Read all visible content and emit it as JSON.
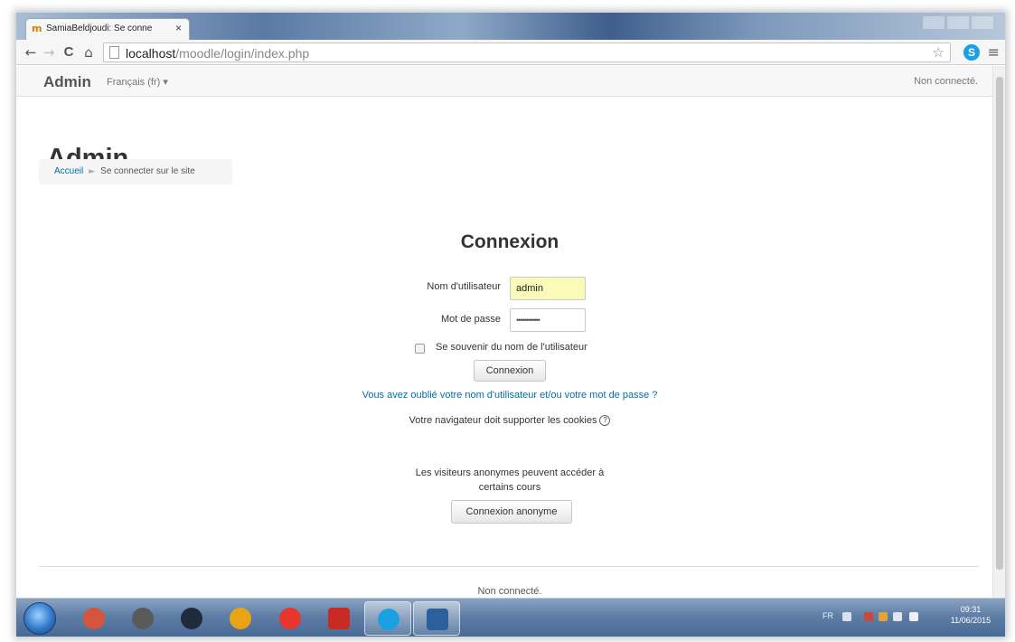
{
  "browser": {
    "tab_title": "SamiaBeldjoudi: Se conne",
    "tab_close": "×",
    "url_host": "localhost",
    "url_path": "/moodle/login/index.php",
    "back": "←",
    "forward": "→",
    "reload": "C",
    "home": "⌂",
    "star": "☆",
    "skype_ext": "S",
    "menu": "≡"
  },
  "navbar": {
    "brand": "Admin",
    "language": "Français (fr) ▾",
    "status": "Non connecté."
  },
  "page": {
    "heading": "Admin",
    "breadcrumb": {
      "home": "Accueil",
      "separator": "►",
      "current": "Se connecter sur le site"
    }
  },
  "login": {
    "title": "Connexion",
    "username_label": "Nom d'utilisateur",
    "username_value": "admin",
    "password_label": "Mot de passe",
    "password_value": "••••••••••••",
    "remember_label": "Se souvenir du nom de l'utilisateur",
    "remember_checked": false,
    "submit": "Connexion",
    "forgot_link": "Vous avez oublié votre nom d'utilisateur et/ou votre mot de passe ?",
    "cookies_notice": "Votre navigateur doit supporter les cookies",
    "help_icon": "?"
  },
  "guest": {
    "line1": "Les visiteurs anonymes peuvent accéder à",
    "line2": "certains cours",
    "button": "Connexion anonyme"
  },
  "footer": {
    "status": "Non connecté."
  },
  "taskbar": {
    "apps": [
      {
        "name": "security-app",
        "icon": "shield-icon",
        "color": "#d4553a"
      },
      {
        "name": "camera-app",
        "icon": "camera-icon",
        "color": "#5a5a5a"
      },
      {
        "name": "media-app",
        "icon": "play-icon",
        "color": "#1f2b3a"
      },
      {
        "name": "chrome-app",
        "icon": "chrome-icon",
        "color": "#e8a417"
      },
      {
        "name": "opera-app",
        "icon": "opera-icon",
        "color": "#e8362f"
      },
      {
        "name": "pdf-app",
        "icon": "pdf-icon",
        "color": "#c92a24"
      },
      {
        "name": "skype-app",
        "icon": "skype-icon",
        "color": "#1ba1e2"
      },
      {
        "name": "explorer-app",
        "icon": "window-icon",
        "color": "#2c5f9e"
      }
    ],
    "tray_lang": "FR",
    "time": "09:31",
    "date": "11/06/2015"
  }
}
